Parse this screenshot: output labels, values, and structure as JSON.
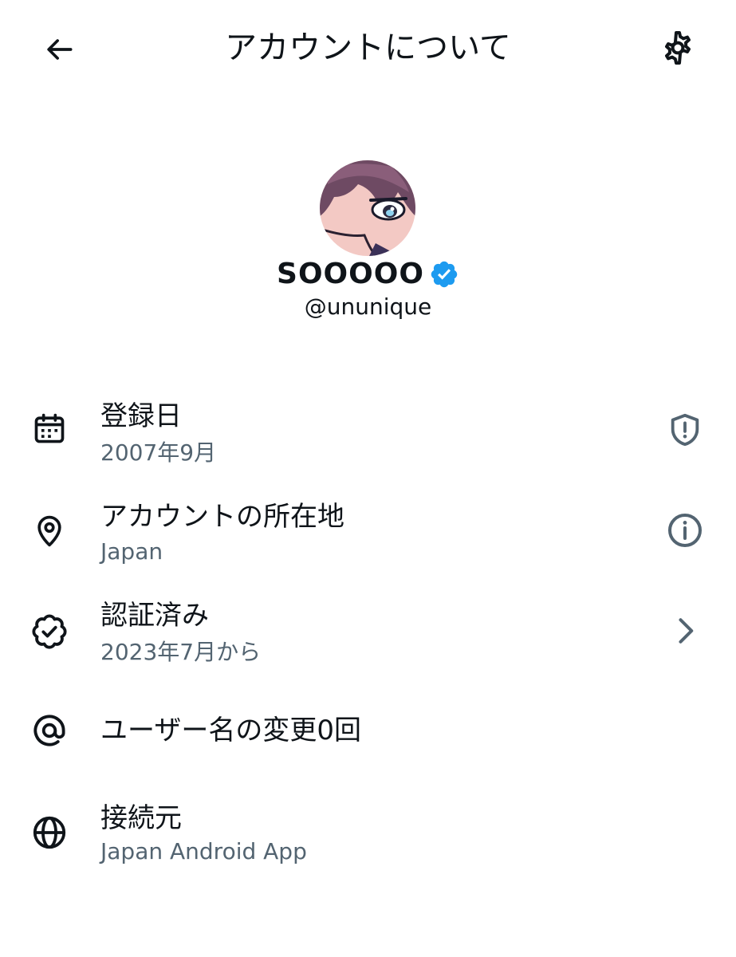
{
  "header": {
    "title": "アカウントについて",
    "back_icon": "arrow-left-icon",
    "settings_icon": "gear-icon"
  },
  "profile": {
    "display_name": "SOOOOO",
    "handle": "@ununique",
    "verified_color": "#1d9bf0"
  },
  "rows": [
    {
      "icon": "calendar-icon",
      "title": "登録日",
      "subtitle": "2007年9月",
      "right_icon": "shield-alert-icon"
    },
    {
      "icon": "location-pin-icon",
      "title": "アカウントの所在地",
      "subtitle": "Japan",
      "right_icon": "info-icon"
    },
    {
      "icon": "verified-badge-icon",
      "title": "認証済み",
      "subtitle": "2023年7月から",
      "right_icon": "chevron-right-icon"
    },
    {
      "icon": "at-sign-icon",
      "title": "ユーザー名の変更0回"
    },
    {
      "icon": "globe-icon",
      "title": "接続元",
      "subtitle": "Japan Android App"
    }
  ],
  "colors": {
    "text_primary": "#0f1419",
    "text_secondary": "#536471",
    "icon_secondary": "#536471",
    "verified_blue": "#1d9bf0"
  }
}
